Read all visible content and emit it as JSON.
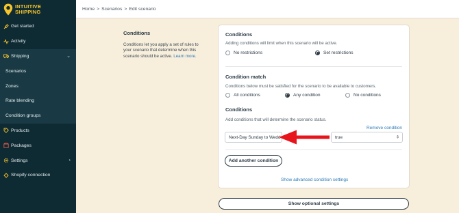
{
  "brand": {
    "line1": "INTUITIVE",
    "line2": "SHIPPING",
    "accent": "#f6c52c",
    "sidebar_bg": "#0e2a33"
  },
  "sidebar": {
    "items": [
      {
        "label": "Get started",
        "icon": "rocket-icon"
      },
      {
        "label": "Activity",
        "icon": "activity-icon"
      },
      {
        "label": "Shipping",
        "icon": "truck-icon"
      },
      {
        "label": "Scenarios"
      },
      {
        "label": "Zones"
      },
      {
        "label": "Rate blending"
      },
      {
        "label": "Condition groups"
      },
      {
        "label": "Products",
        "icon": "tag-icon"
      },
      {
        "label": "Packages",
        "icon": "box-icon"
      },
      {
        "label": "Settings",
        "icon": "gear-icon"
      },
      {
        "label": "Shopify connection",
        "icon": "link-icon"
      }
    ]
  },
  "breadcrumb": {
    "home": "Home",
    "scenarios": "Scenarios",
    "current": "Edit scenario",
    "separator": ">"
  },
  "description": {
    "title": "Conditions",
    "body": "Conditions let you apply a set of rules to your scenario that determine when this scenario should be active.",
    "link": "Learn more."
  },
  "conditions": {
    "title": "Conditions",
    "help": "Adding conditions will limit when this scenario will be active.",
    "options": [
      "No restrictions",
      "Set restrictions"
    ],
    "selected": "Set restrictions"
  },
  "match": {
    "title": "Condition match",
    "help": "Conditions below must be satisfied for the scenario to be available to customers.",
    "options": [
      "All conditions",
      "Any condition",
      "No conditions"
    ],
    "selected": "Any condition"
  },
  "condition_list": {
    "title": "Conditions",
    "help": "Add conditions that will determine the scenario status.",
    "remove_link": "Remove condition",
    "group_value": "Next-Day Sunday to Wedd",
    "value_select": "true",
    "add_button": "Add another condition",
    "advanced_link": "Show advanced condition settings"
  },
  "optional_button": "Show optional settings",
  "annotation_color": "#e8141b"
}
